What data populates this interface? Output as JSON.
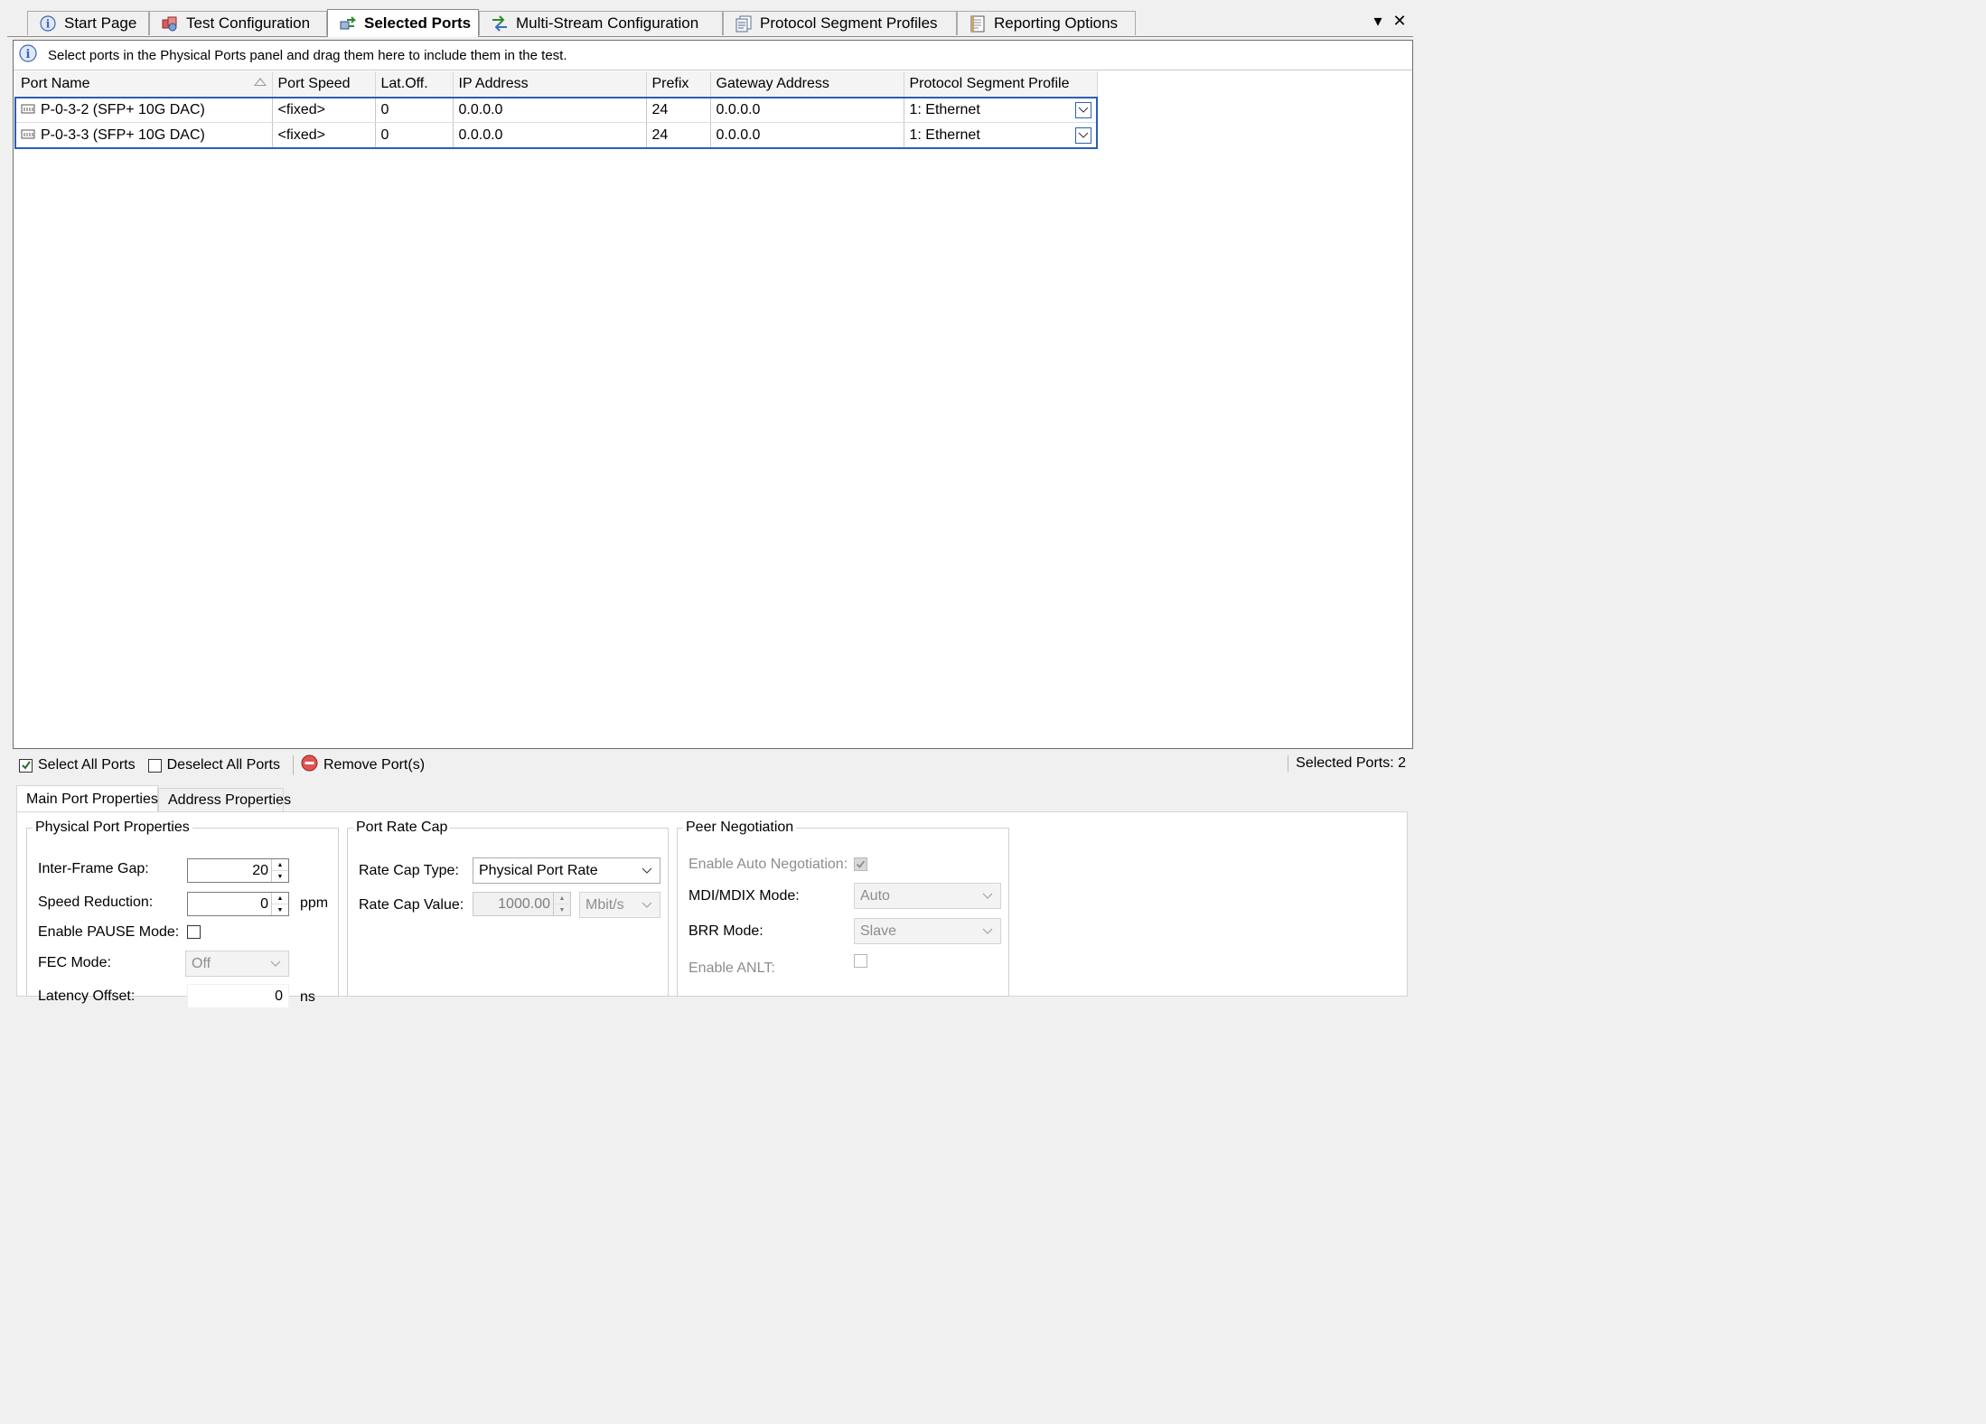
{
  "tabs": [
    {
      "label": "Start Page",
      "icon": "info-icon"
    },
    {
      "label": "Test Configuration",
      "icon": "test-config-icon"
    },
    {
      "label": "Selected Ports",
      "icon": "ports-icon",
      "active": true
    },
    {
      "label": "Multi-Stream Configuration",
      "icon": "streams-icon"
    },
    {
      "label": "Protocol Segment Profiles",
      "icon": "profiles-icon"
    },
    {
      "label": "Reporting Options",
      "icon": "report-icon"
    }
  ],
  "strip": {
    "dropdown_glyph": "▾",
    "close_glyph": "✕"
  },
  "info": {
    "text": "Select ports in the Physical Ports panel and drag them here to include them in the test.",
    "icon_glyph": "i"
  },
  "grid": {
    "columns": [
      "Port Name",
      "Port Speed",
      "Lat.Off.",
      "IP Address",
      "Prefix",
      "Gateway Address",
      "Protocol Segment Profile"
    ],
    "rows": [
      {
        "port_name": "P-0-3-2 (SFP+ 10G DAC)",
        "port_speed": "<fixed>",
        "lat_off": "0",
        "ip": "0.0.0.0",
        "prefix": "24",
        "gateway": "0.0.0.0",
        "profile": "1: Ethernet"
      },
      {
        "port_name": "P-0-3-3 (SFP+ 10G DAC)",
        "port_speed": "<fixed>",
        "lat_off": "0",
        "ip": "0.0.0.0",
        "prefix": "24",
        "gateway": "0.0.0.0",
        "profile": "1: Ethernet"
      }
    ]
  },
  "toolbar": {
    "select_all": "Select All Ports",
    "deselect_all": "Deselect All Ports",
    "remove": "Remove Port(s)",
    "selected_count": "Selected Ports: 2"
  },
  "prop_tabs": {
    "main": "Main Port Properties",
    "address": "Address Properties"
  },
  "physical": {
    "legend": "Physical Port Properties",
    "ifg_label": "Inter-Frame Gap:",
    "ifg_value": "20",
    "speed_red_label": "Speed Reduction:",
    "speed_red_value": "0",
    "speed_red_unit": "ppm",
    "pause_label": "Enable PAUSE Mode:",
    "fec_label": "FEC Mode:",
    "fec_value": "Off",
    "latency_label": "Latency Offset:",
    "latency_value": "0",
    "latency_unit": "ns"
  },
  "rate_cap": {
    "legend": "Port Rate Cap",
    "type_label": "Rate Cap Type:",
    "type_value": "Physical Port Rate",
    "value_label": "Rate Cap Value:",
    "value": "1000.00",
    "unit": "Mbit/s"
  },
  "peer": {
    "legend": "Peer Negotiation",
    "auto_neg_label": "Enable Auto Negotiation:",
    "mdi_label": "MDI/MDIX Mode:",
    "mdi_value": "Auto",
    "brr_label": "BRR Mode:",
    "brr_value": "Slave",
    "anlt_label": "Enable ANLT:"
  }
}
